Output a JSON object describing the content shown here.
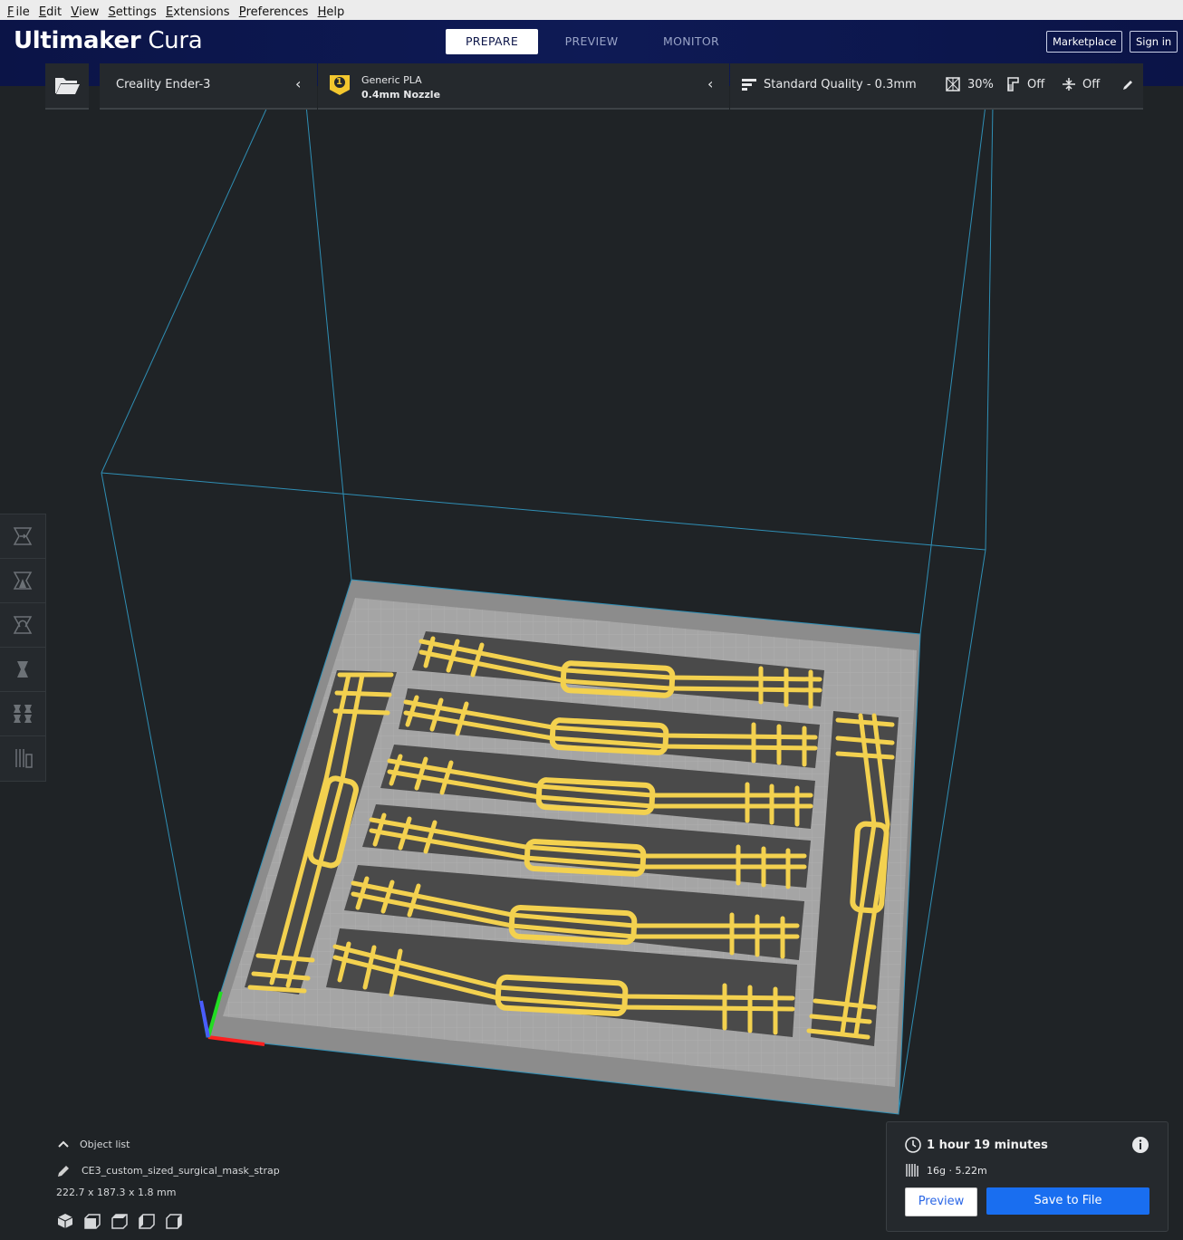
{
  "menu": {
    "items": [
      {
        "underline": "F",
        "rest": "ile"
      },
      {
        "underline": "E",
        "rest": "dit"
      },
      {
        "underline": "V",
        "rest": "iew"
      },
      {
        "underline": "S",
        "rest": "ettings"
      },
      {
        "underline": "E",
        "rest": "xtensions"
      },
      {
        "underline": "P",
        "rest": "references"
      },
      {
        "underline": "H",
        "rest": "elp"
      }
    ]
  },
  "header": {
    "logo_bold": "Ultimaker",
    "logo_light": "Cura",
    "tabs": [
      "PREPARE",
      "PREVIEW",
      "MONITOR"
    ],
    "active_tab": "PREPARE",
    "marketplace_label": "Marketplace",
    "signin_label": "Sign in"
  },
  "toolbar": {
    "printer": "Creality Ender-3",
    "extruder_number": "1",
    "material": "Generic PLA",
    "nozzle": "0.4mm Nozzle",
    "profile": "Standard Quality - 0.3mm",
    "infill": "30%",
    "support": "Off",
    "adhesion": "Off"
  },
  "object_list": {
    "title": "Object list",
    "object_name": "CE3_custom_sized_surgical_mask_strap",
    "dimensions": "222.7 x 187.3 x 1.8 mm"
  },
  "print_info": {
    "time": "1 hour 19 minutes",
    "material_usage": "16g · 5.22m",
    "preview_label": "Preview",
    "save_label": "Save to File"
  },
  "colors": {
    "header_bg": "#0b1447",
    "accent_blue": "#196ef0",
    "model_yellow": "#f5d85a",
    "build_plate": "#9a9a9a",
    "viewport_bg": "#1f2326"
  }
}
